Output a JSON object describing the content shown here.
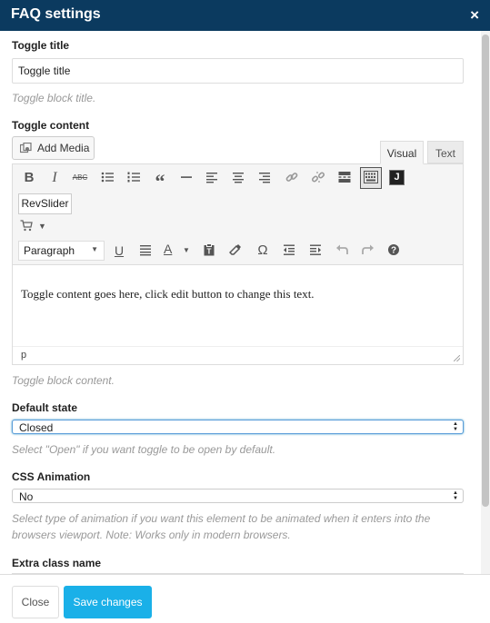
{
  "modal": {
    "title": "FAQ settings",
    "close_glyph": "×"
  },
  "toggle_title": {
    "label": "Toggle title",
    "value": "Toggle title",
    "hint": "Toggle block title."
  },
  "toggle_content": {
    "label": "Toggle content",
    "add_media_label": "Add Media",
    "tabs": {
      "visual": "Visual",
      "text": "Text"
    },
    "revslider_label": "RevSlider",
    "format_select": "Paragraph",
    "body_text": "Toggle content goes here, click edit button to change this text.",
    "status_path": "p",
    "hint": "Toggle block content.",
    "icons_row1": [
      "bold-icon",
      "italic-icon",
      "strikethrough-icon",
      "bullet-list-icon",
      "numbered-list-icon",
      "blockquote-icon",
      "horizontal-line-icon",
      "align-left-icon",
      "align-center-icon",
      "align-right-icon",
      "link-icon",
      "unlink-icon",
      "read-more-icon",
      "toolbar-toggle-icon",
      "shortcode-j-icon"
    ],
    "icons_row3": [
      "underline-icon",
      "justify-icon",
      "text-color-icon",
      "paste-text-icon",
      "clear-format-icon",
      "special-character-icon",
      "outdent-icon",
      "indent-icon",
      "undo-icon",
      "redo-icon",
      "help-icon"
    ]
  },
  "default_state": {
    "label": "Default state",
    "selected": "Closed",
    "hint": "Select \"Open\" if you want toggle to be open by default."
  },
  "css_animation": {
    "label": "CSS Animation",
    "selected": "No",
    "hint": "Select type of animation if you want this element to be animated when it enters into the browsers viewport. Note: Works only in modern browsers."
  },
  "extra_class": {
    "label": "Extra class name"
  },
  "footer": {
    "close_label": "Close",
    "save_label": "Save changes"
  },
  "colors": {
    "header_bg": "#0b3a5f",
    "accent": "#1ab0e8",
    "focus": "#5b9dd9"
  }
}
